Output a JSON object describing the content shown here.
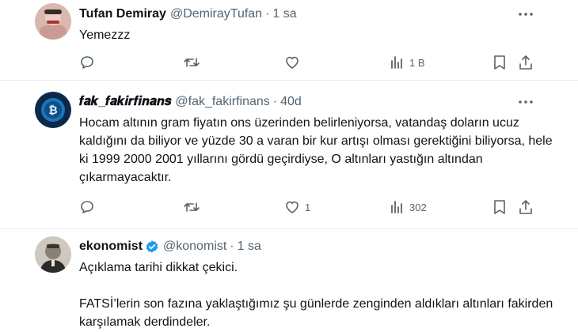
{
  "tweets": [
    {
      "name": "Tufan Demiray",
      "handle": "@DemirayTufan",
      "time": "1 sa",
      "text": "Yemezzz",
      "reply_count": "",
      "retweet_count": "",
      "like_count": "",
      "view_count": "1 B"
    },
    {
      "name": "𝒇𝒂𝒌_𝒇𝒂𝒌𝒊𝒓𝒇𝒊𝒏𝒂𝒏𝒔",
      "handle": "@fak_fakirfinans",
      "time": "40d",
      "text": "Hocam altının gram fiyatın ons üzerinden belirleniyorsa, vatandaş doların ucuz kaldığını da biliyor ve yüzde 30 a varan bir kur artışı olması gerektiğini biliyorsa, hele ki 1999 2000 2001 yıllarını gördü geçirdiyse, O altınları yastığın altından çıkarmayacaktır.",
      "reply_count": "",
      "retweet_count": "",
      "like_count": "1",
      "view_count": "302"
    },
    {
      "name": "ekonomist",
      "handle": "@konomist",
      "time": "1 sa",
      "text": "Açıklama tarihi dikkat çekici.\n\nFATSİ’lerin son fazına yaklaştığımız şu günlerde zenginden aldıkları altınları fakirden karşılamak derdindeler.",
      "verified": true
    }
  ],
  "colors": {
    "text": "#0f1419",
    "muted": "#536471",
    "divider": "#e6ecf0",
    "verified": "#1d9bf0"
  }
}
